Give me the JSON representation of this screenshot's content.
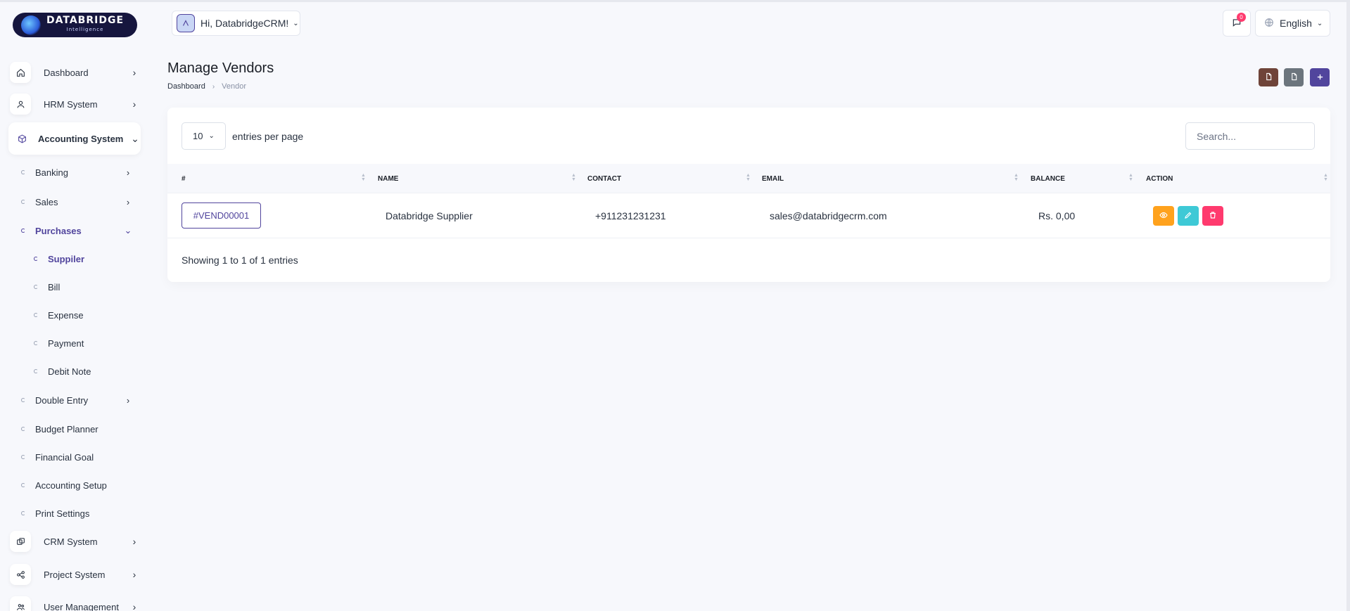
{
  "brand": {
    "name": "DATABRIDGE",
    "tagline": "Intelligence"
  },
  "header": {
    "greeting": "Hi, DatabridgeCRM!",
    "notification_count": "0",
    "language": "English"
  },
  "sidebar": {
    "main": [
      {
        "label": "Dashboard",
        "icon": "home-icon"
      },
      {
        "label": "HRM System",
        "icon": "user-icon"
      },
      {
        "label": "Accounting System",
        "icon": "box-icon"
      },
      {
        "label": "CRM System",
        "icon": "layers-icon"
      },
      {
        "label": "Project System",
        "icon": "share-icon"
      },
      {
        "label": "User Management",
        "icon": "users-icon"
      }
    ],
    "accounting": [
      {
        "label": "Banking"
      },
      {
        "label": "Sales"
      },
      {
        "label": "Purchases"
      },
      {
        "label": "Double Entry"
      },
      {
        "label": "Budget Planner"
      },
      {
        "label": "Financial Goal"
      },
      {
        "label": "Accounting Setup"
      },
      {
        "label": "Print Settings"
      }
    ],
    "purchases": [
      {
        "label": "Suppiler"
      },
      {
        "label": "Bill"
      },
      {
        "label": "Expense"
      },
      {
        "label": "Payment"
      },
      {
        "label": "Debit Note"
      }
    ]
  },
  "page": {
    "title": "Manage Vendors",
    "breadcrumb": [
      "Dashboard",
      "Vendor"
    ],
    "actions": [
      {
        "name": "export-button",
        "color": "#6f4439",
        "icon": "file-icon"
      },
      {
        "name": "import-button",
        "color": "#6c757d",
        "icon": "file-icon"
      },
      {
        "name": "create-button",
        "color": "#51459d",
        "icon": "plus-icon"
      }
    ]
  },
  "table": {
    "per_page_value": "10",
    "per_page_label": "entries per page",
    "search_placeholder": "Search...",
    "columns": [
      "#",
      "NAME",
      "CONTACT",
      "EMAIL",
      "BALANCE",
      "ACTION"
    ],
    "rows": [
      {
        "id": "#VEND00001",
        "name": "Databridge Supplier",
        "contact": "+911231231231",
        "email": "sales@databridgecrm.com",
        "balance": "Rs. 0,00"
      }
    ],
    "row_actions": [
      {
        "name": "view-button",
        "color": "#ffa21d",
        "icon": "eye-icon"
      },
      {
        "name": "edit-button",
        "color": "#3ec9d6",
        "icon": "pencil-icon"
      },
      {
        "name": "delete-button",
        "color": "#ff3a6e",
        "icon": "trash-icon"
      }
    ],
    "footer_info": "Showing 1 to 1 of 1 entries"
  }
}
